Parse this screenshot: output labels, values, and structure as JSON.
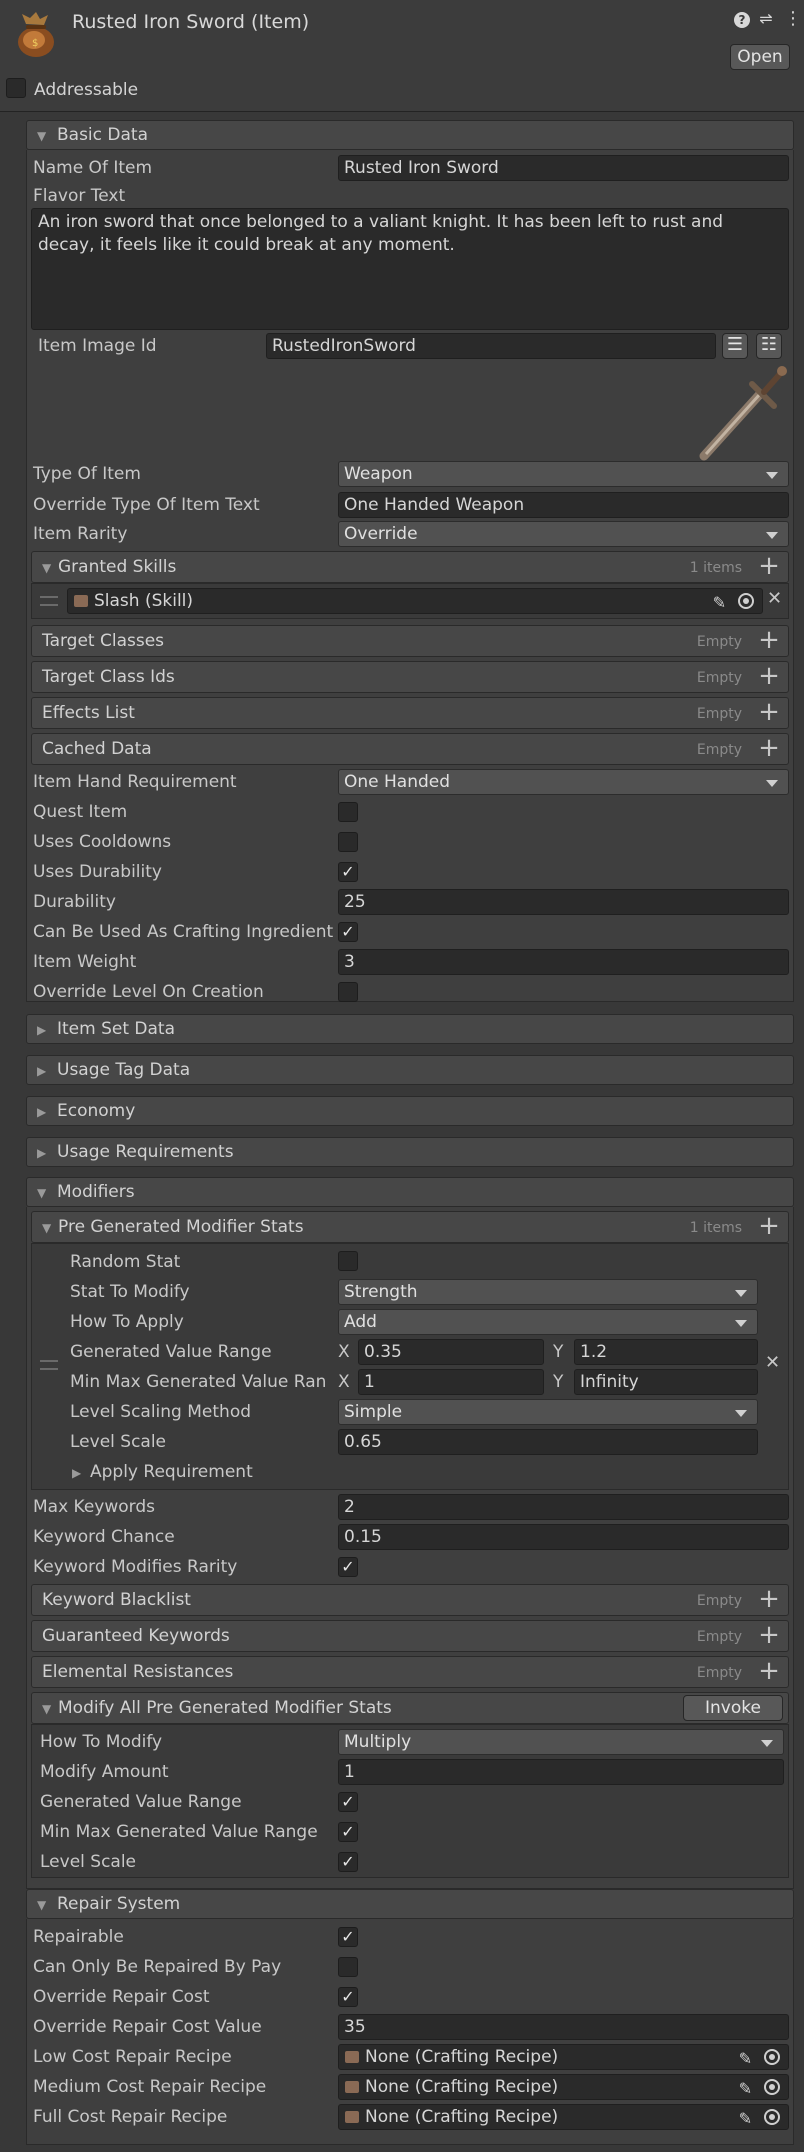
{
  "header": {
    "title": "Rusted Iron Sword (Item)",
    "open_button": "Open",
    "addressable_label": "Addressable",
    "icons": [
      "help-icon",
      "preset-icon",
      "more-icon"
    ]
  },
  "basic": {
    "title": "Basic Data",
    "name_label": "Name Of Item",
    "name_value": "Rusted Iron Sword",
    "flavor_label": "Flavor Text",
    "flavor_value": "An iron sword that once belonged to a valiant knight. It has been left to rust and decay, it feels like it could break at any moment.",
    "image_label": "Item Image Id",
    "image_value": "RustedIronSword",
    "type_label": "Type Of Item",
    "type_value": "Weapon",
    "override_type_label": "Override Type Of Item Text",
    "override_type_value": "One Handed Weapon",
    "rarity_label": "Item Rarity",
    "rarity_value": "Override"
  },
  "granted_skills": {
    "label": "Granted Skills",
    "count": "1 items",
    "item": "Slash (Skill)"
  },
  "empty_lists": [
    {
      "label": "Target Classes",
      "count": "Empty"
    },
    {
      "label": "Target Class Ids",
      "count": "Empty"
    },
    {
      "label": "Effects List",
      "count": "Empty"
    },
    {
      "label": "Cached Data",
      "count": "Empty"
    }
  ],
  "props": {
    "hand_label": "Item Hand Requirement",
    "hand_value": "One Handed",
    "quest_label": "Quest Item",
    "quest": false,
    "cooldown_label": "Uses Cooldowns",
    "cooldown": false,
    "durability_use_label": "Uses Durability",
    "durability_use": true,
    "durability_label": "Durability",
    "durability_value": "25",
    "crafting_label": "Can Be Used As Crafting Ingredient",
    "crafting": true,
    "weight_label": "Item Weight",
    "weight_value": "3",
    "override_level_label": "Override Level On Creation",
    "override_level": false
  },
  "collapsed_sections": [
    "Item Set Data",
    "Usage Tag Data",
    "Economy",
    "Usage Requirements"
  ],
  "modifiers": {
    "title": "Modifiers",
    "pre_label": "Pre Generated Modifier Stats",
    "pre_count": "1 items",
    "random_label": "Random Stat",
    "random": false,
    "stat_label": "Stat To Modify",
    "stat_value": "Strength",
    "apply_label": "How To Apply",
    "apply_value": "Add",
    "range_label": "Generated Value Range",
    "range_x": "0.35",
    "range_y": "1.2",
    "minmax_label": "Min Max Generated Value Ran",
    "minmax_x": "1",
    "minmax_y": "Infinity",
    "x_label": "X",
    "y_label": "Y",
    "scaling_label": "Level Scaling Method",
    "scaling_value": "Simple",
    "scale_label": "Level Scale",
    "scale_value": "0.65",
    "apply_req_label": "Apply Requirement",
    "max_kw_label": "Max Keywords",
    "max_kw_value": "2",
    "kw_chance_label": "Keyword Chance",
    "kw_chance_value": "0.15",
    "kw_rarity_label": "Keyword Modifies Rarity",
    "kw_rarity": true,
    "lists": [
      {
        "label": "Keyword Blacklist",
        "count": "Empty"
      },
      {
        "label": "Guaranteed Keywords",
        "count": "Empty"
      },
      {
        "label": "Elemental Resistances",
        "count": "Empty"
      }
    ],
    "modify_all_label": "Modify All Pre Generated Modifier Stats",
    "invoke": "Invoke",
    "how_label": "How To Modify",
    "how_value": "Multiply",
    "amount_label": "Modify Amount",
    "amount_value": "1",
    "gvr_label": "Generated Value Range",
    "gvr": true,
    "mmgvr_label": "Min Max Generated Value Range",
    "mmgvr": true,
    "ls_label": "Level Scale",
    "ls": true
  },
  "repair": {
    "title": "Repair System",
    "repairable_label": "Repairable",
    "repairable": true,
    "pay_label": "Can Only Be Repaired By Pay",
    "pay": false,
    "override_label": "Override Repair Cost",
    "override": true,
    "override_value_label": "Override Repair Cost Value",
    "override_value": "35",
    "low_label": "Low Cost Repair Recipe",
    "medium_label": "Medium Cost Repair Recipe",
    "full_label": "Full Cost Repair Recipe",
    "recipe_value": "None (Crafting Recipe)"
  },
  "colors": {
    "bg": "#383838",
    "field": "#2a2a2a",
    "header": "#474747"
  }
}
